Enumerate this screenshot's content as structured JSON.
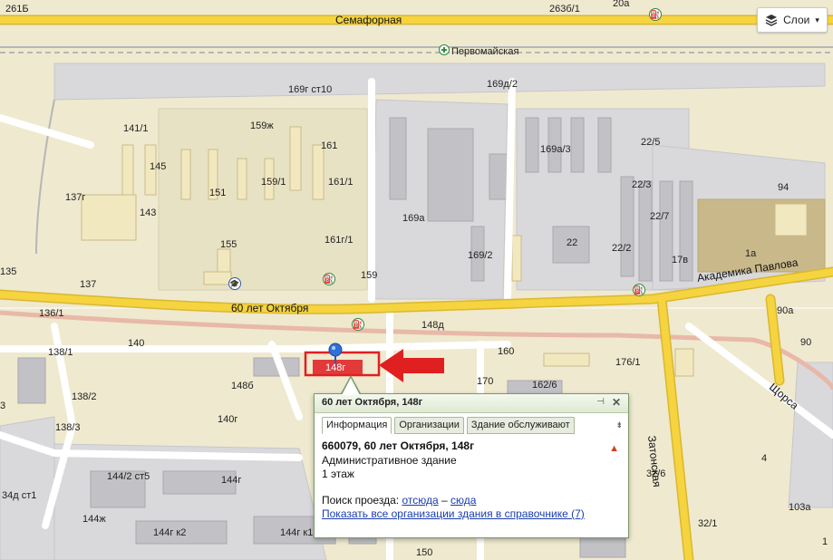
{
  "map": {
    "streets": {
      "semafornaya": "Семафорная",
      "pervomayskaya": "Первомайская",
      "let60": "60 лет Октября",
      "akademika": "Академика Павлова",
      "zatonskaya": "Затонская",
      "shchorsa": "Щорса"
    },
    "house_labels": [
      "261Б",
      "263б/1",
      "20а",
      "169г ст10",
      "169д/2",
      "141/1",
      "159ж",
      "161",
      "169а/3",
      "22/5",
      "145",
      "161/1",
      "159/1",
      "151",
      "143",
      "137г",
      "22/3",
      "94",
      "169а",
      "22/7",
      "155",
      "161г/1",
      "169/2",
      "22",
      "22/2",
      "17в",
      "1а",
      "135",
      "137",
      "159",
      "136/1",
      "148д",
      "90а",
      "140",
      "138/1",
      "160",
      "176/1",
      "90",
      "148г",
      "148б",
      "170",
      "162/6",
      "138/2",
      "3",
      "140г",
      "138/3",
      "4",
      "144/2 ст5",
      "144г",
      "32/6",
      "34д ст1",
      "144ж",
      "144г к2",
      "144г к1",
      "150",
      "32/1",
      "103а",
      "1"
    ]
  },
  "layers": {
    "label": "Слои",
    "icon": "layers-icon",
    "arrow": "▾"
  },
  "popup": {
    "title": "60 лет Октября, 148г",
    "tabs": [
      "Информация",
      "Организации",
      "Здание обслуживают"
    ],
    "address": "660079, 60 лет Октября, 148г",
    "type": "Административное здание",
    "floors": "1 этаж",
    "route_label": "Поиск проезда:",
    "route_from": "отсюда",
    "route_dash": "–",
    "route_to": "сюда",
    "show_all": "Показать все организации здания в справочнике (7)"
  },
  "colors": {
    "highlight": "#e02020",
    "road_yellow": "#f5d43f",
    "rail": "#d9a59a",
    "popup_border": "#7a9b6a"
  }
}
